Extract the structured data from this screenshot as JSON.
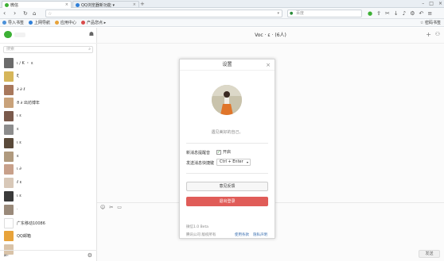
{
  "browser": {
    "tabs": [
      {
        "label": "微信",
        "icon_color": "#3cb034"
      },
      {
        "label": "QQ浏览器新功能 ▾",
        "icon_color": "#2f7fd8"
      }
    ],
    "new_tab": "+",
    "search_placeholder": "百度",
    "bookmarks": [
      {
        "label": "导入书签",
        "color": "#4a90d9"
      },
      {
        "label": "上网导航",
        "color": "#2f7fd8"
      },
      {
        "label": "应用中心",
        "color": "#e8a33a"
      },
      {
        "label": "产品您点 ▸",
        "color": "#d94b4b"
      }
    ],
    "bookmarks_right": "☆ 密码书签"
  },
  "wechat": {
    "search_placeholder": "搜索",
    "contacts": [
      {
        "name": "ι ∕ K ・ ε",
        "color": "#6b6b6b"
      },
      {
        "name": "ξ",
        "color": "#d6b65a"
      },
      {
        "name": "∂ ∂ ℓ",
        "color": "#a8785c"
      },
      {
        "name": "ϑ ∂ 出坊博年",
        "color": "#c9a27a"
      },
      {
        "name": "ι ε",
        "color": "#7a5a4c"
      },
      {
        "name": "ε",
        "color": "#8d8d8d"
      },
      {
        "name": "ι ε",
        "color": "#5a4a3a"
      },
      {
        "name": "ε",
        "color": "#b09a7e"
      },
      {
        "name": "ι ∂",
        "color": "#c8a08a"
      },
      {
        "name": "ℓ ε",
        "color": "#d8c8b8"
      },
      {
        "name": "ι ε",
        "color": "#3a3a3a"
      },
      {
        "name": "·",
        "color": "#9a8a7a"
      },
      {
        "name": "广东移动10086",
        "color": "#ffffff"
      },
      {
        "name": "QQ邮箱",
        "color": "#e8a33a"
      },
      {
        "name": "",
        "color": "#d9c3a8"
      }
    ],
    "chat_title": "Voc · ε · (6人)",
    "send_label": "发送"
  },
  "settings": {
    "title": "设置",
    "signature": "遇见美好的自己。",
    "notify_label": "新消息提醒音",
    "notify_check_label": "开启",
    "send_key_label": "发送消息快捷键",
    "send_key_value": "Ctrl + Enter",
    "feedback_label": "意见反馈",
    "logout_label": "退出登录",
    "version": "微信1.0 Beta",
    "copyright": "腾讯公司 版权所有",
    "terms_link": "使用条款",
    "privacy_link": "隐私声明"
  }
}
